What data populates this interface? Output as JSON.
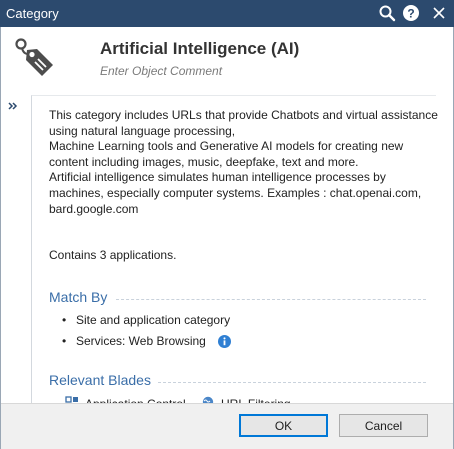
{
  "window": {
    "title": "Category"
  },
  "header": {
    "title": "Artificial Intelligence (AI)",
    "comment_placeholder": "Enter Object Comment"
  },
  "description": {
    "lines": [
      "This category includes URLs that provide Chatbots and virtual assistance",
      "using natural language processing,",
      "Machine Learning tools and Generative AI models for creating new",
      "content including images, music, deepfake, text and more.",
      "Artificial intelligence simulates human intelligence processes by",
      "machines, especially computer systems. Examples :  chat.openai.com,",
      "bard.google.com"
    ],
    "apps_count": "Contains 3 applications."
  },
  "match_by": {
    "title": "Match By",
    "items": [
      "Site and application category",
      "Services: Web Browsing"
    ]
  },
  "relevant_blades": {
    "title": "Relevant Blades",
    "items": [
      {
        "label": "Application Control",
        "icon": "application-control-icon"
      },
      {
        "label": "URL Filtering",
        "icon": "url-filtering-icon"
      }
    ]
  },
  "buttons": {
    "ok": "OK",
    "cancel": "Cancel"
  },
  "colors": {
    "titlebar": "#2c4a6e",
    "section_title": "#3a6ea8",
    "info_icon": "#2f7fd3",
    "footer": "#f0f0f0"
  }
}
